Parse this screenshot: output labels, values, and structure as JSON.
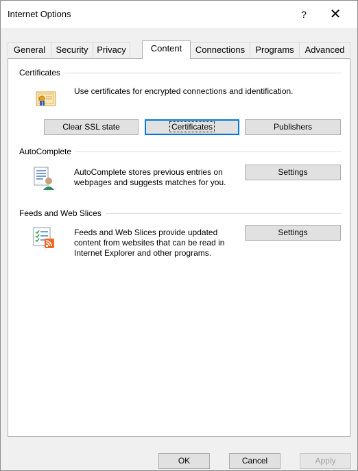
{
  "window": {
    "title": "Internet Options",
    "help_label": "?",
    "close_label": "✕"
  },
  "tabs": [
    {
      "label": "General"
    },
    {
      "label": "Security"
    },
    {
      "label": "Privacy"
    },
    {
      "label": "Content",
      "active": true
    },
    {
      "label": "Connections"
    },
    {
      "label": "Programs"
    },
    {
      "label": "Advanced"
    }
  ],
  "certificates": {
    "heading": "Certificates",
    "description": "Use certificates for encrypted connections and identification.",
    "icon": "certificate-icon",
    "buttons": {
      "clear_ssl": "Clear SSL state",
      "certificates": "Certificates",
      "publishers": "Publishers"
    }
  },
  "autocomplete": {
    "heading": "AutoComplete",
    "description": "AutoComplete stores previous entries on webpages and suggests matches for you.",
    "icon": "autocomplete-icon",
    "settings_label": "Settings"
  },
  "feeds": {
    "heading": "Feeds and Web Slices",
    "description": "Feeds and Web Slices provide updated content from websites that can be read in Internet Explorer and other programs.",
    "icon": "feeds-icon",
    "settings_label": "Settings"
  },
  "footer": {
    "ok": "OK",
    "cancel": "Cancel",
    "apply": "Apply"
  },
  "colors": {
    "accent": "#0078d7",
    "rss": "#f26522"
  }
}
